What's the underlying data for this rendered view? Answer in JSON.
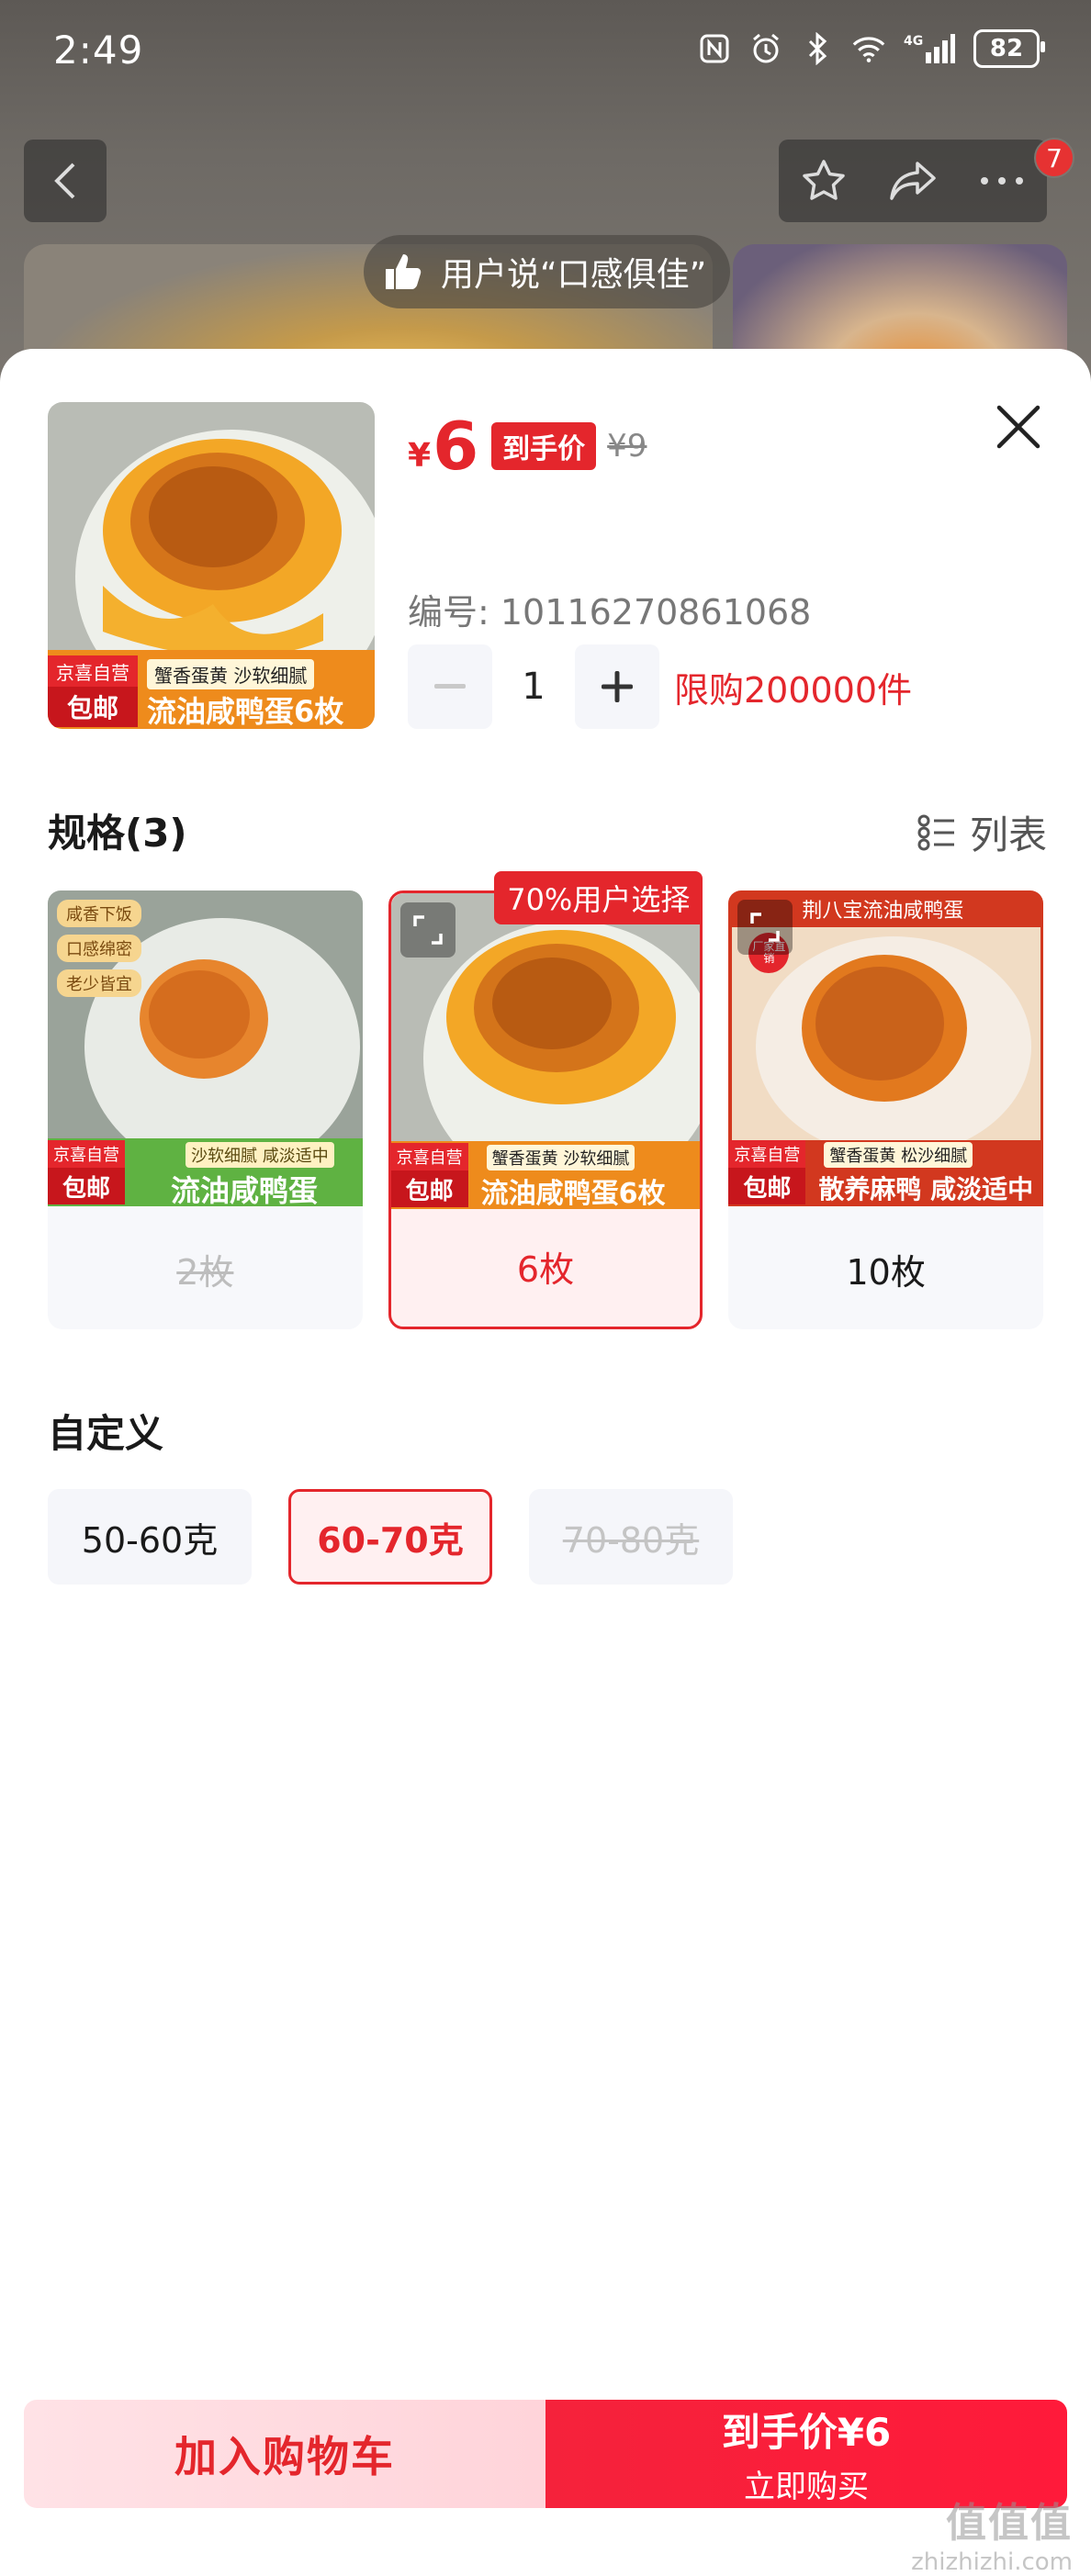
{
  "status_bar": {
    "time": "2:49",
    "battery": "82",
    "network": "4G"
  },
  "background": {
    "notification_count": "7",
    "review_pill": "用户说“口感俱佳”"
  },
  "product": {
    "thumb": {
      "tag_top": "京喜自营",
      "tag_bottom": "包邮",
      "subtitle": "蟹香蛋黄 沙软细腻",
      "title": "流油咸鸭蛋6枚"
    },
    "price_symbol": "¥",
    "price": "6",
    "price_tag": "到手价",
    "original_price": "¥9",
    "sku_code": "编号: 10116270861068",
    "quantity": "1",
    "limit": "限购200000件"
  },
  "spec_section": {
    "title": "规格(3)",
    "view_toggle": "列表",
    "options": [
      {
        "label": "2枚",
        "state": "disabled",
        "img": {
          "side_tags": [
            "咸香下饭",
            "口感绵密",
            "老少皆宜"
          ],
          "tag_top": "京喜自营",
          "tag_bottom": "包邮",
          "subtitle": "沙软细腻 咸淡适中",
          "title": "流油咸鸭蛋"
        }
      },
      {
        "label": "6枚",
        "state": "selected",
        "badge": "70%用户选择",
        "img": {
          "tag_top": "京喜自营",
          "tag_bottom": "包邮",
          "subtitle": "蟹香蛋黄 沙软细腻",
          "title": "流油咸鸭蛋6枚"
        }
      },
      {
        "label": "10枚",
        "state": "normal",
        "img": {
          "header": "荆八宝流油咸鸭蛋",
          "corner": "厂家直销",
          "tag_top": "京喜自营",
          "tag_bottom": "包邮",
          "subtitle": "蟹香蛋黄 松沙细腻",
          "title": "散养麻鸭 咸淡适中"
        }
      }
    ]
  },
  "custom_section": {
    "title": "自定义",
    "options": [
      {
        "label": "50-60克",
        "state": "normal"
      },
      {
        "label": "60-70克",
        "state": "selected"
      },
      {
        "label": "70-80克",
        "state": "disabled"
      }
    ]
  },
  "actions": {
    "add_to_cart": "加入购物车",
    "buy_line1": "到手价¥6",
    "buy_line2": "立即购买"
  },
  "watermark": {
    "line1": "值值值",
    "line2": "zhizhizhi.com"
  },
  "colors": {
    "accent": "#e4262c",
    "selected_bg": "#fff0f1",
    "option_bg": "#f5f6fa"
  }
}
